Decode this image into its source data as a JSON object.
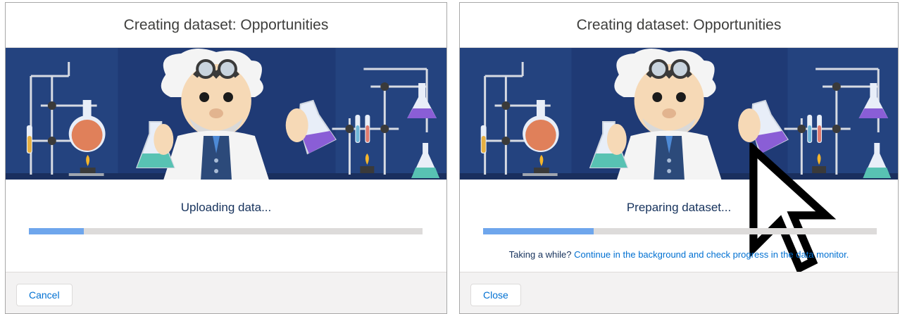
{
  "colors": {
    "header_text": "#3e3e3c",
    "scene_bg": "#1f3a75",
    "progress_track": "#dddbda",
    "progress_fill": "#6ea6ec",
    "link": "#0070d2",
    "footer_bg": "#f3f2f2"
  },
  "modals": [
    {
      "title": "Creating dataset: Opportunities",
      "status": "Uploading data...",
      "progress_fraction": 0.14,
      "footer_button": "Cancel"
    },
    {
      "title": "Creating dataset: Opportunities",
      "status": "Preparing dataset...",
      "progress_fraction": 0.28,
      "hint_prefix": "Taking a while? ",
      "hint_link": "Continue in the background and check progress in the data monitor.",
      "footer_button": "Close"
    }
  ],
  "icons": [
    "einstein-scientist-illustration",
    "lab-flask-icon",
    "burner-icon",
    "mouse-pointer-icon"
  ]
}
